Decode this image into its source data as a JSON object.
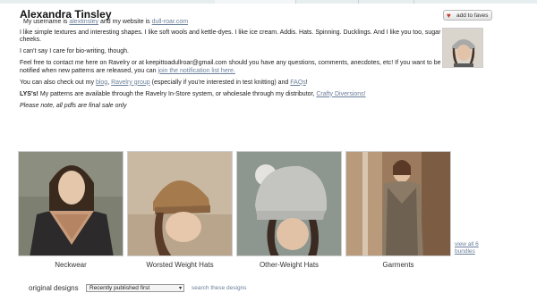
{
  "profile": {
    "name": "Alexandra Tinsley",
    "intro_prefix": "My username is",
    "username": "alextinsley",
    "website_prefix": "and my website is",
    "website": "dull-roar.com",
    "bio": "I like simple textures and interesting shapes. I like soft wools and kettle-dyes. I like ice cream. Addis. Hats. Spinning. Ducklings. And I like you too, sugar cheeks.",
    "bio2": "I can't say I care for bio-writing, though.",
    "contact_text": "Feel free to contact me here on Ravelry or at keepittoadullroar@gmail.com should you have any questions, comments, anecdotes, etc! If you want to be notified when new patterns are released, you can",
    "contact_link": "join the notification list here.",
    "also_prefix": "You can also check out my",
    "blog_link": "blog",
    "group_link": "Ravelry group",
    "also_mid": "(especially if you're interested in test knitting) and",
    "faq_link": "FAQs",
    "lys_label": "LYS's!",
    "lys_text": "My patterns are available through the Ravelry In-Store system, or wholesale through my distributor,",
    "distributor_link": "Crafty Diversions!",
    "note": "Please note, all pdfs are final sale only"
  },
  "faves_button": {
    "label": "add to faves"
  },
  "bundles": [
    {
      "caption": "Neckwear"
    },
    {
      "caption": "Worsted Weight Hats"
    },
    {
      "caption": "Other-Weight Hats"
    },
    {
      "caption": "Garments"
    }
  ],
  "view_all": {
    "line1": "view all 6",
    "line2": "bundles"
  },
  "designs": {
    "label": "original designs",
    "sort_selected": "Recently published first",
    "search_link": "search these designs"
  },
  "colors": {
    "link": "#6a7f9a",
    "heart": "#c0392b"
  }
}
